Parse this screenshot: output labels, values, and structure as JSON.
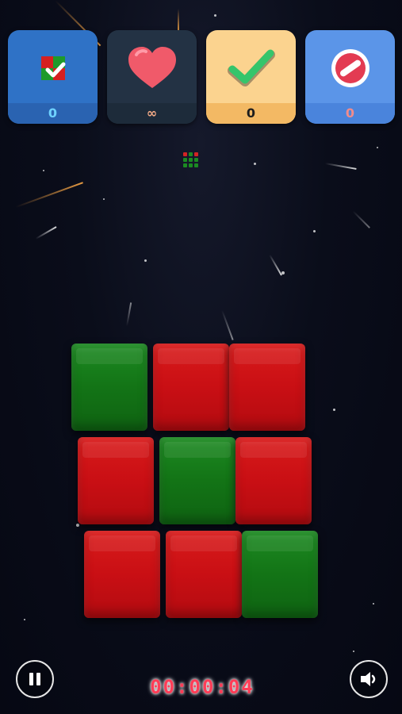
{
  "topbar": {
    "cards": [
      {
        "name": "hint-cubes",
        "count": "0",
        "icon": "cubes-check-icon",
        "bg": "#2f72c6"
      },
      {
        "name": "lives",
        "count": "∞",
        "icon": "heart-icon",
        "bg": "#233244"
      },
      {
        "name": "solve",
        "count": "0",
        "icon": "checkmark-icon",
        "bg": "#fbd38f"
      },
      {
        "name": "skip",
        "count": "0",
        "icon": "no-entry-icon",
        "bg": "#5b95e8"
      }
    ]
  },
  "preview": {
    "rows": [
      [
        "red",
        "green",
        "red"
      ],
      [
        "green",
        "green",
        "green"
      ],
      [
        "green",
        "green",
        "green"
      ]
    ]
  },
  "board": {
    "rows": [
      [
        "green",
        "red",
        "red"
      ],
      [
        "red",
        "green",
        "red"
      ],
      [
        "red",
        "red",
        "green"
      ]
    ]
  },
  "controls": {
    "timer": "00:00:04",
    "pause_icon": "pause-icon",
    "sound_icon": "speaker-icon"
  },
  "colors": {
    "red": "#d01515",
    "green": "#157a19",
    "timer": "#ff3d57"
  }
}
